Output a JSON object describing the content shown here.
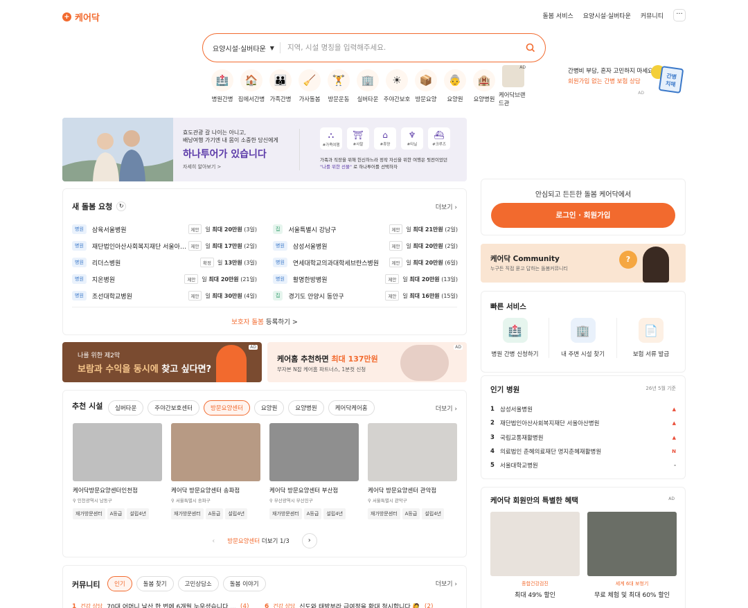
{
  "header": {
    "logo": "케어닥",
    "nav": [
      "돌봄 서비스",
      "요양시설·실버타운",
      "커뮤니티"
    ],
    "more": "···"
  },
  "search": {
    "category": "요양시설·실버타운",
    "placeholder": "지역, 시설 명칭을 입력해주세요."
  },
  "categories": [
    {
      "label": "병원간병",
      "icon": "🏥"
    },
    {
      "label": "집에서간병",
      "icon": "🏠"
    },
    {
      "label": "가족간병",
      "icon": "👪"
    },
    {
      "label": "가사돌봄",
      "icon": "🧹"
    },
    {
      "label": "방문운동",
      "icon": "🏋"
    },
    {
      "label": "실버타운",
      "icon": "🏢"
    },
    {
      "label": "주야간보호",
      "icon": "☀"
    },
    {
      "label": "방문요양",
      "icon": "📦"
    },
    {
      "label": "요양원",
      "icon": "👵"
    },
    {
      "label": "요양병원",
      "icon": "🏨"
    },
    {
      "label": "케어닥브랜드관",
      "icon": "",
      "ad": "AD"
    }
  ],
  "top_ad": {
    "line1": "간병비 부담, 혼자 고민하지 마세요!",
    "line2": "회원가입 없는 간병 보험 상담",
    "ad": "AD",
    "sign": "간병\n치매"
  },
  "banner": {
    "line1": "효도관광 갈 나이는 아니고,\n배낭여행 가기엔 내 몸이 소중한 당신에게",
    "title": "하나투어가 있습니다",
    "link": "자세히 알아보기 >",
    "icons": [
      "#가족여행",
      "#사찰",
      "#휴양",
      "#타닐",
      "#크루즈"
    ],
    "desc": "가족과 직장을 위해 헌신하느라 정작 자신을 위한 여행은 뒷전이었던",
    "desc2_hl": "\"나를 위한 선물\"",
    "desc2": " 로 하나투어를 선택하자"
  },
  "requests": {
    "title": "새 돌봄 요청",
    "more": "더보기",
    "left": [
      {
        "tag": "병원",
        "name": "삼육서울병원",
        "status": "제안",
        "price_pre": "일 ",
        "price": "최대 20만원",
        "days": " (3일)"
      },
      {
        "tag": "병원",
        "name": "재단법인아산사회복지재단 서울아산...",
        "status": "제안",
        "price_pre": "일 ",
        "price": "최대 17만원",
        "days": " (2일)"
      },
      {
        "tag": "병원",
        "name": "리더스병원",
        "status": "확정",
        "price_pre": "일 ",
        "price": "13만원",
        "days": " (3일)"
      },
      {
        "tag": "병원",
        "name": "지온병원",
        "status": "제안",
        "price_pre": "일 ",
        "price": "최대 20만원",
        "days": " (21일)"
      },
      {
        "tag": "병원",
        "name": "조선대학교병원",
        "status": "제안",
        "price_pre": "일 ",
        "price": "최대 30만원",
        "days": " (4일)"
      }
    ],
    "right": [
      {
        "tag": "집",
        "name": "서울특별시 강남구",
        "status": "제안",
        "price_pre": "일 ",
        "price": "최대 21만원",
        "days": " (2일)"
      },
      {
        "tag": "병원",
        "name": "삼성서울병원",
        "status": "제안",
        "price_pre": "일 ",
        "price": "최대 20만원",
        "days": " (2일)"
      },
      {
        "tag": "병원",
        "name": "연세대학교의과대학세브란스병원",
        "status": "제안",
        "price_pre": "일 ",
        "price": "최대 20만원",
        "days": " (6일)"
      },
      {
        "tag": "병원",
        "name": "활명한방병원",
        "status": "제안",
        "price_pre": "일 ",
        "price": "최대 20만원",
        "days": " (13일)"
      },
      {
        "tag": "집",
        "name": "경기도 안양시 동안구",
        "status": "제안",
        "price_pre": "일 ",
        "price": "최대 16만원",
        "days": " (15일)"
      }
    ],
    "register_hl": "보호자 돌봄",
    "register": " 등록하기 >"
  },
  "ad1": {
    "line1": "나를 위한 제2막",
    "hl": "보람과 수익을 동시에",
    "rest": " 찾고 싶다면?",
    "ad": "AD"
  },
  "ad2": {
    "pre": "케어홈 추천하면 ",
    "hl": "최대 137만원",
    "sub": "무자본 N잡 케어홈 파트너스, 1분컷 신청",
    "ad": "AD"
  },
  "recommended": {
    "title": "추천 시설",
    "more": "더보기",
    "pills": [
      "실버타운",
      "주야간보호센터",
      "방문요양센터",
      "요양원",
      "요양병원",
      "케어닥케어홈"
    ],
    "pill_ad": "AD",
    "facilities": [
      {
        "name": "케어닥방문요양센터인천점",
        "loc": "인천광역시 남동구",
        "tags": [
          "재가방문센터",
          "A등급",
          "설립4년"
        ],
        "color": "#bfbfbf"
      },
      {
        "name": "케어닥 방문요양센터 송파점",
        "loc": "서울특별시 송파구",
        "tags": [
          "재가방문센터",
          "A등급",
          "설립4년"
        ],
        "color": "#b79a84"
      },
      {
        "name": "케어닥 방문요양센터 부산점",
        "loc": "부산광역시 부산진구",
        "tags": [
          "재가방문센터",
          "A등급",
          "설립4년"
        ],
        "color": "#8f8f8f"
      },
      {
        "name": "케어닥 방문요양센터 관악점",
        "loc": "서울특별시 관악구",
        "tags": [
          "재가방문센터",
          "A등급",
          "설립4년"
        ],
        "color": "#d4d2cf"
      }
    ],
    "pager_hl": "방문요양센터",
    "pager": " 더보기 1/3"
  },
  "community": {
    "title": "커뮤니티",
    "more": "더보기",
    "pills": [
      "인기",
      "돌봄 찾기",
      "고민상담소",
      "돌봄 이야기"
    ],
    "items": [
      {
        "n": "1",
        "tag": "건강 상담",
        "text": "70대 어머니 날산 한 번에 6개월 누우셨습니다 ...",
        "count": "(4)"
      },
      {
        "n": "6",
        "tag": "건강 상담",
        "text": "신도와 태방부라 급여정을 확대 청시합니다 🙋",
        "count": "(2)"
      }
    ]
  },
  "login": {
    "text": "안심되고 든든한 돌봄 케어닥에서",
    "button": "로그인 · 회원가입"
  },
  "cmty_banner": {
    "title": "케어닥 Community",
    "sub": "누구든 직접 묻고 답하는 돌봄커뮤니티"
  },
  "quick": {
    "title": "빠른 서비스",
    "items": [
      {
        "label": "병원 간병 신청하기",
        "icon": "🏥",
        "bg": "#e6f5ee"
      },
      {
        "label": "내 주변 시설 찾기",
        "icon": "🏢",
        "bg": "#e9f1fb"
      },
      {
        "label": "보험 서류 발급",
        "icon": "📄",
        "bg": "#fdf0e4"
      }
    ]
  },
  "popular": {
    "title": "인기 병원",
    "date": "26년 5월 기준",
    "items": [
      {
        "n": "1",
        "name": "삼성서울병원",
        "trend": "▲"
      },
      {
        "n": "2",
        "name": "재단법인아산사회복지재단 서울아산병원",
        "trend": "▲"
      },
      {
        "n": "3",
        "name": "국립교통재활병원",
        "trend": "▲"
      },
      {
        "n": "4",
        "name": "의료법인 춘혜의료재단 명지춘혜재활병원",
        "trend": "N"
      },
      {
        "n": "5",
        "name": "서울대학교병원",
        "trend": "-"
      }
    ]
  },
  "perks": {
    "title": "케어닥 회원만의 특별한 혜택",
    "ad": "AD",
    "items": [
      {
        "tag": "종합건강검진",
        "text": "최대 49% 할인",
        "bg": "#e8e2dc"
      },
      {
        "tag": "세계 6대 보청기",
        "text": "무료 체험 및 최대 60% 할인",
        "bg": "#6a6e66"
      }
    ]
  },
  "colors": {
    "accent": "#f26a2e",
    "purple": "#5b3aa8"
  }
}
